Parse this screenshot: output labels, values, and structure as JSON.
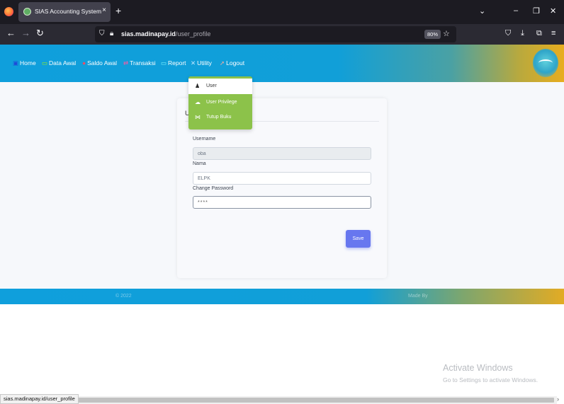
{
  "browser": {
    "tab_title": "SIAS Accounting System",
    "tab_close": "×",
    "new_tab": "+",
    "url_host": "sias.madinapay.id",
    "url_path": "/user_profile",
    "zoom": "80%",
    "status_url": "sias.madinapay.id/user_profile"
  },
  "menu": {
    "items": [
      {
        "icon": "home-icon",
        "label": "Home"
      },
      {
        "icon": "monitor-icon",
        "label": "Data Awal"
      },
      {
        "icon": "wallet-icon",
        "label": "Saldo Awal"
      },
      {
        "icon": "exchange-icon",
        "label": "Transaksi"
      },
      {
        "icon": "report-icon",
        "label": "Report"
      },
      {
        "icon": "wrench-icon",
        "label": "Utility"
      },
      {
        "icon": "logout-icon",
        "label": "Logout"
      }
    ]
  },
  "dropdown": {
    "items": [
      {
        "icon": "user-icon",
        "label": "User",
        "active": true
      },
      {
        "icon": "users-icon",
        "label": "User Privilege",
        "active": false
      },
      {
        "icon": "book-icon",
        "label": "Tutup Buku",
        "active": false
      }
    ]
  },
  "form": {
    "title": "U",
    "username_label": "Username",
    "username_value": "oba",
    "name_label": "Nama",
    "name_value": "ELPK",
    "password_label": "Change Password",
    "password_value": "****",
    "save_label": "Save"
  },
  "footer": {
    "left": "© 2022",
    "right": "Made By"
  },
  "watermark": {
    "title": "Activate Windows",
    "subtitle": "Go to Settings to activate Windows."
  },
  "colors": {
    "header_blue": "#0f9fdc",
    "header_gold": "#e8ad1e",
    "dropdown_green": "#8cc24a",
    "save_button": "#6777ef"
  }
}
